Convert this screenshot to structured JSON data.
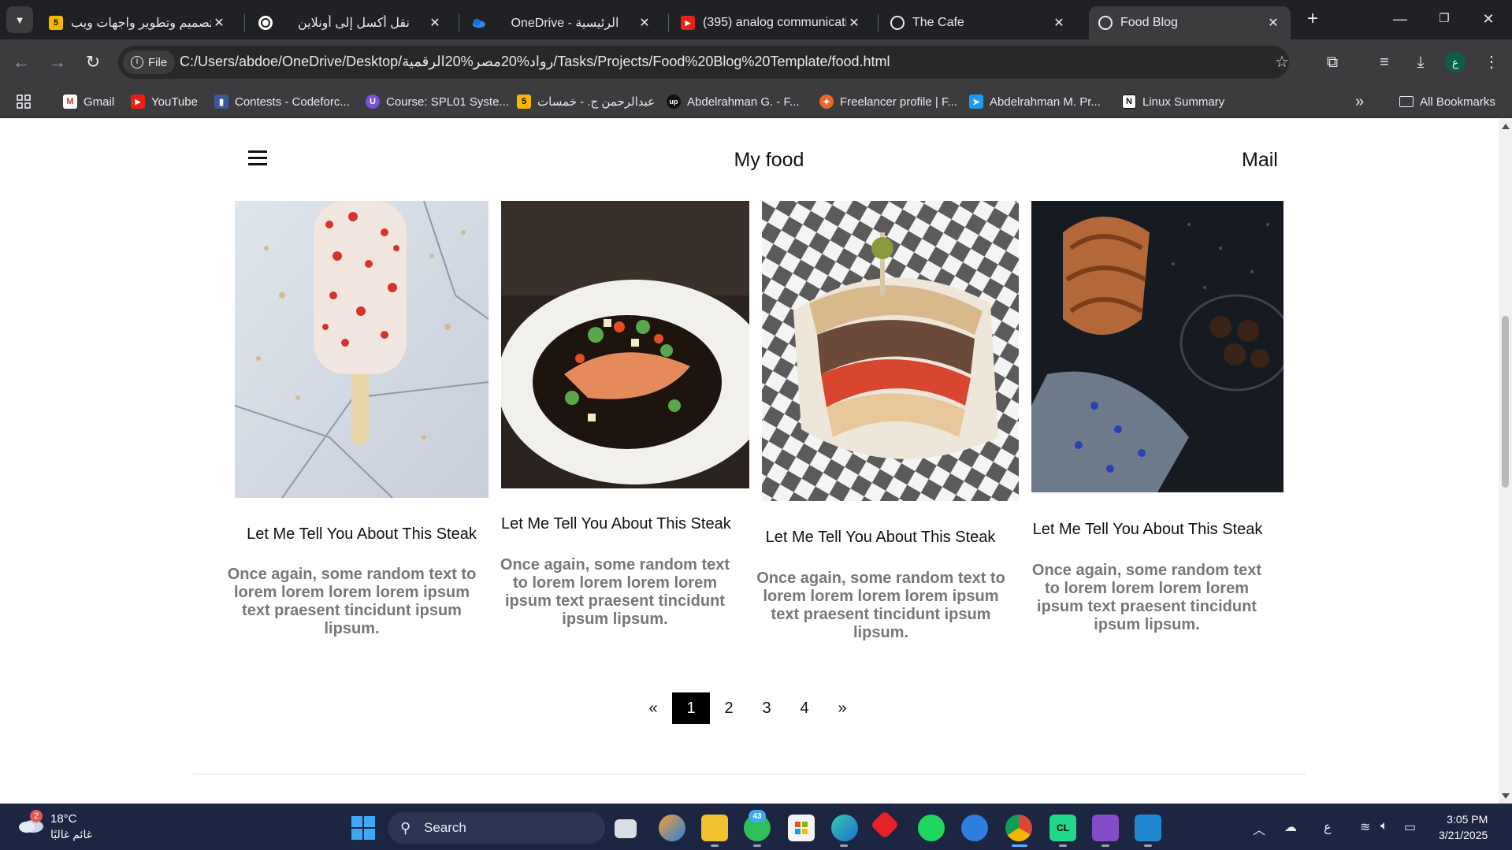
{
  "browser": {
    "tabs": [
      {
        "title": "تصميم وتطوير واجهات ويب",
        "favicon": "5"
      },
      {
        "title": "نقل أكسل إلى أونلاين",
        "favicon": "openai-icon"
      },
      {
        "title": "OneDrive - الرئيسية",
        "favicon": "onedrive-icon"
      },
      {
        "title": "(395) analog communicatio",
        "favicon": "youtube-icon"
      },
      {
        "title": "The Cafe",
        "favicon": "globe-icon"
      },
      {
        "title": "Food Blog",
        "favicon": "globe-icon"
      }
    ],
    "address_chip": "File",
    "url": "C:/Users/abdoe/OneDrive/Desktop/رواد%20مصر%20الرقمية/Tasks/Projects/Food%20Blog%20Template/food.html",
    "profile_initial": "ع",
    "bookmarks": [
      "Gmail",
      "YouTube",
      "Contests - Codeforc...",
      "Course: SPL01 Syste...",
      "عبدالرحمن ج. - خمسات",
      "Abdelrahman G. - F...",
      "Freelancer profile | F...",
      "Abdelrahman M. Pr...",
      "Linux Summary"
    ],
    "bookmarks_overflow": "»",
    "all_bookmarks": "All Bookmarks"
  },
  "site": {
    "title": "My food",
    "mail": "Mail",
    "cards": [
      {
        "title": "Let Me Tell You About This Steak",
        "desc": "Once again, some random text to lorem lorem lorem lorem ipsum text praesent tincidunt ipsum lipsum."
      },
      {
        "title": "Let Me Tell You About This Steak",
        "desc": "Once again, some random text to lorem lorem lorem lorem ipsum text praesent tincidunt ipsum lipsum."
      },
      {
        "title": "Let Me Tell You About This Steak",
        "desc": "Once again, some random text to lorem lorem lorem lorem ipsum text praesent tincidunt ipsum lipsum."
      },
      {
        "title": "Let Me Tell You About This Steak",
        "desc": "Once again, some random text to lorem lorem lorem lorem ipsum text praesent tincidunt ipsum lipsum."
      }
    ],
    "pagination": {
      "prev": "«",
      "pages": [
        "1",
        "2",
        "3",
        "4"
      ],
      "current": "1",
      "next": "»"
    }
  },
  "taskbar": {
    "weather_temp": "18°C",
    "weather_desc": "غائم غالبًا",
    "weather_badge": "2",
    "search_label": "Search",
    "whatsapp_badge": "43",
    "lang": "ع",
    "time": "3:05 PM",
    "date": "3/21/2025"
  },
  "colors": {
    "chrome_dark": "#202124",
    "chrome_toolbar": "#3c3c3f",
    "taskbar": "#1c2541",
    "pager_active": "#000000",
    "desc_gray": "#777777"
  }
}
